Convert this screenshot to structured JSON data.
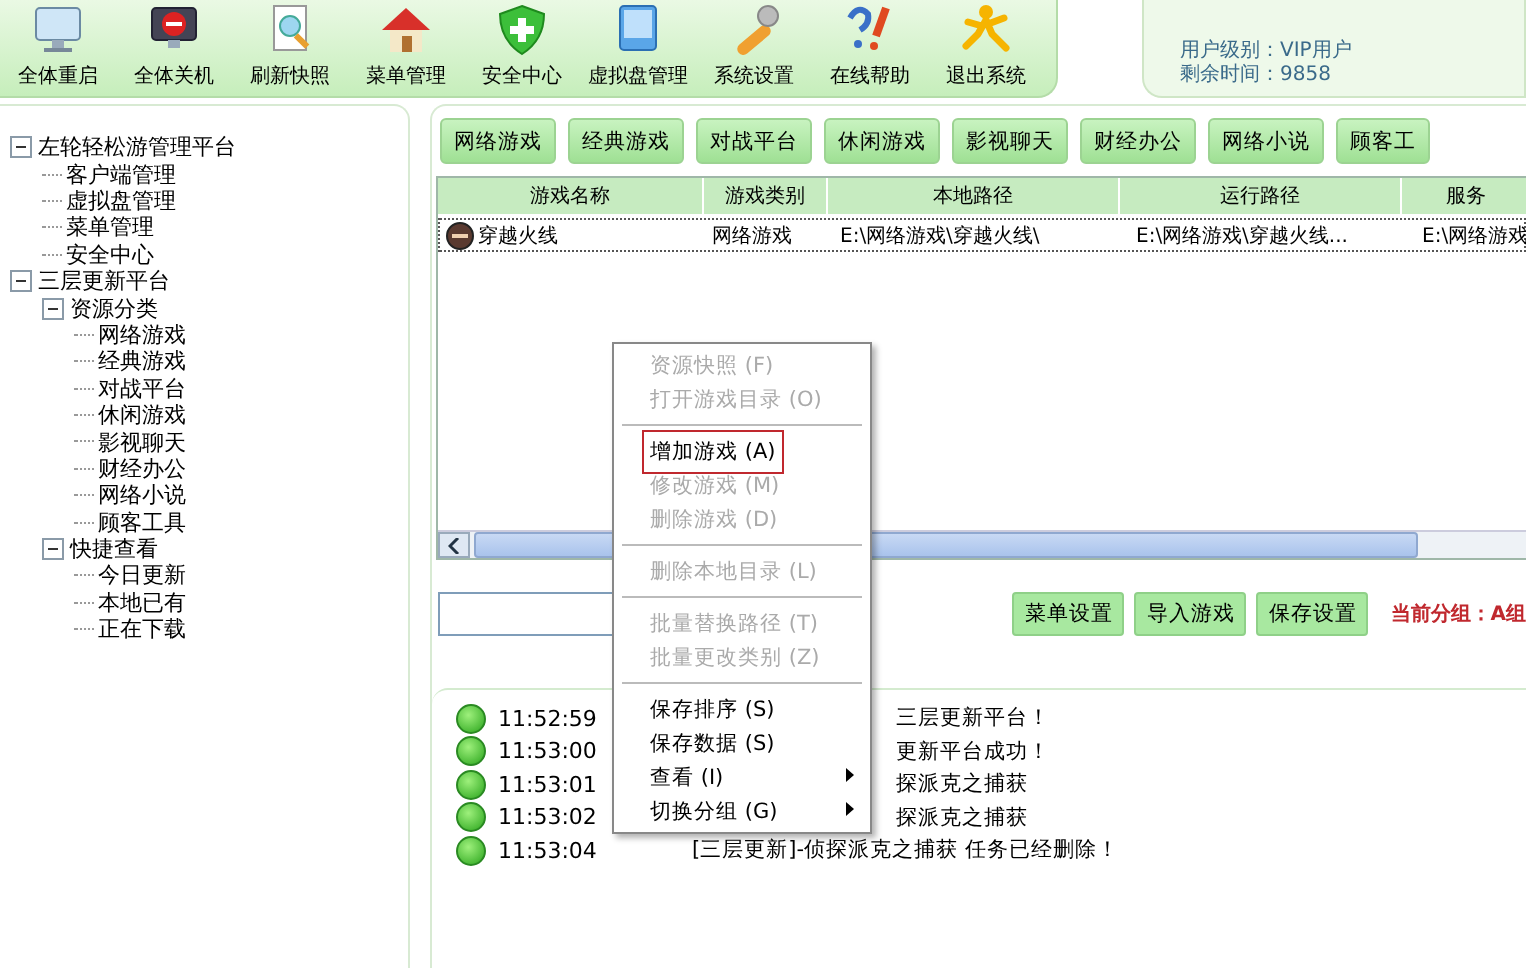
{
  "toolbar": [
    "全体重启",
    "全体关机",
    "刷新快照",
    "菜单管理",
    "安全中心",
    "虚拟盘管理",
    "系统设置",
    "在线帮助",
    "退出系统"
  ],
  "user_info": [
    "用户级别：VIP用户",
    "剩余时间：9858"
  ],
  "tree": [
    {
      "label": "左轮轻松游管理平台",
      "expanded": true,
      "children": [
        {
          "label": "客户端管理"
        },
        {
          "label": "虚拟盘管理"
        },
        {
          "label": "菜单管理"
        },
        {
          "label": "安全中心"
        }
      ]
    },
    {
      "label": "三层更新平台",
      "expanded": true,
      "children": [
        {
          "label": "资源分类",
          "expanded": true,
          "children": [
            {
              "label": "网络游戏"
            },
            {
              "label": "经典游戏"
            },
            {
              "label": "对战平台"
            },
            {
              "label": "休闲游戏"
            },
            {
              "label": "影视聊天"
            },
            {
              "label": "财经办公"
            },
            {
              "label": "网络小说"
            },
            {
              "label": "顾客工具"
            }
          ]
        },
        {
          "label": "快捷查看",
          "expanded": true,
          "children": [
            {
              "label": "今日更新"
            },
            {
              "label": "本地已有"
            },
            {
              "label": "正在下载"
            }
          ]
        }
      ]
    }
  ],
  "categories": [
    "网络游戏",
    "经典游戏",
    "对战平台",
    "休闲游戏",
    "影视聊天",
    "财经办公",
    "网络小说",
    "顾客工"
  ],
  "table": {
    "columns": [
      "游戏名称",
      "游戏类别",
      "本地路径",
      "运行路径",
      "服务"
    ],
    "rows": [
      {
        "cells": [
          "穿越火线",
          "网络游戏",
          "E:\\网络游戏\\穿越火线\\",
          "E:\\网络游戏\\穿越火线...",
          "E:\\网络游戏"
        ],
        "selected": true
      }
    ]
  },
  "actions": [
    "菜单设置",
    "导入游戏",
    "保存设置"
  ],
  "current_group": "当前分组：A组",
  "log": [
    {
      "time": "11:52:59",
      "message": "三层更新平台！",
      "covered": true
    },
    {
      "time": "11:53:00",
      "message": "更新平台成功！",
      "covered": true
    },
    {
      "time": "11:53:01",
      "message": "探派克之捕获",
      "covered": true
    },
    {
      "time": "11:53:02",
      "message": "探派克之捕获",
      "covered": true
    },
    {
      "time": "11:53:04",
      "message": "[三层更新]-侦探派克之捕获 任务已经删除！",
      "covered": false
    }
  ],
  "context_menu": [
    {
      "kind": "item",
      "label": "资源快照",
      "key": "(F)",
      "disabled": true,
      "highlighted": false
    },
    {
      "kind": "item",
      "label": "打开游戏目录",
      "key": "(O)",
      "disabled": true,
      "highlighted": false
    },
    {
      "kind": "separator"
    },
    {
      "kind": "item",
      "label": "增加游戏",
      "key": "(A)",
      "disabled": false,
      "highlighted": true
    },
    {
      "kind": "item",
      "label": "修改游戏",
      "key": "(M)",
      "disabled": true,
      "highlighted": false
    },
    {
      "kind": "item",
      "label": "删除游戏",
      "key": "(D)",
      "disabled": true,
      "highlighted": false
    },
    {
      "kind": "separator"
    },
    {
      "kind": "item",
      "label": "删除本地目录",
      "key": "(L)",
      "disabled": true,
      "highlighted": false
    },
    {
      "kind": "separator"
    },
    {
      "kind": "item",
      "label": "批量替换路径",
      "key": "(T)",
      "disabled": true,
      "highlighted": false
    },
    {
      "kind": "item",
      "label": "批量更改类别",
      "key": "(Z)",
      "disabled": true,
      "highlighted": false
    },
    {
      "kind": "separator"
    },
    {
      "kind": "item",
      "label": "保存排序",
      "key": "(S)",
      "disabled": false,
      "highlighted": false
    },
    {
      "kind": "item",
      "label": "保存数据",
      "key": "(S)",
      "disabled": false,
      "highlighted": false
    },
    {
      "kind": "submenu",
      "label": "查看",
      "key": "(I)",
      "disabled": false,
      "highlighted": false
    },
    {
      "kind": "submenu",
      "label": "切换分组",
      "key": "(G)",
      "disabled": false,
      "highlighted": false
    }
  ]
}
